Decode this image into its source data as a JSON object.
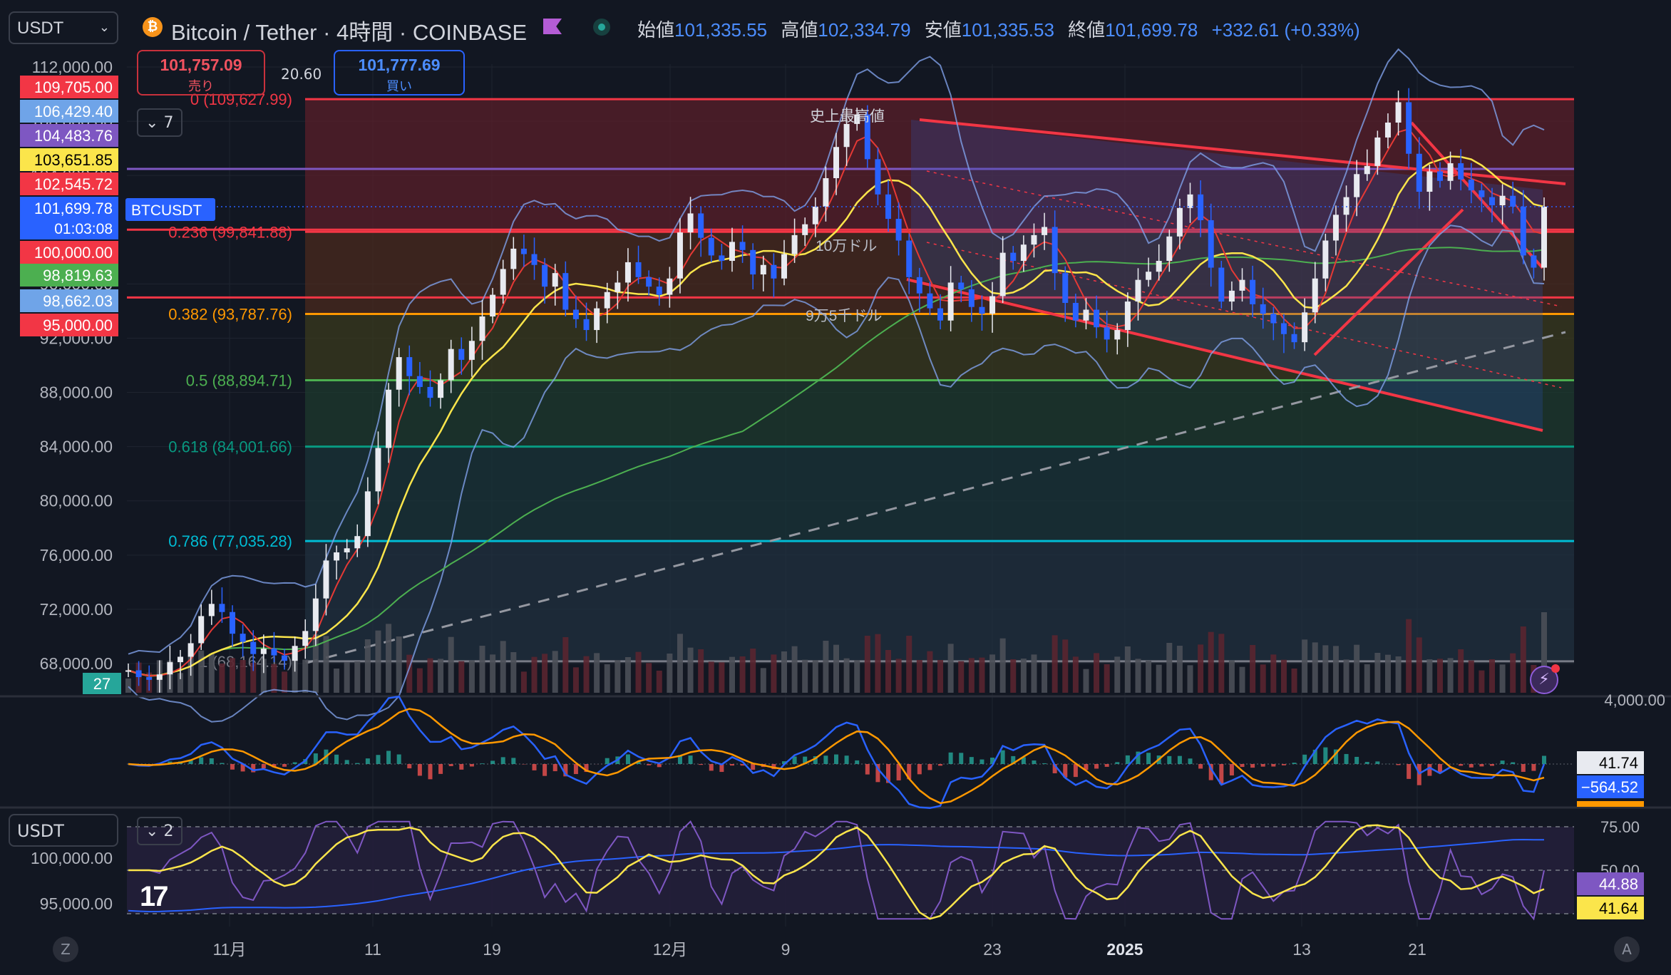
{
  "header": {
    "symbol_select": "USDT",
    "title": "Bitcoin / Tether · 4時間 · COINBASE",
    "ohlc": [
      {
        "k": "始値",
        "v": "101,335.55"
      },
      {
        "k": "高値",
        "v": "102,334.79"
      },
      {
        "k": "安値",
        "v": "101,335.53"
      },
      {
        "k": "終値",
        "v": "101,699.78"
      },
      {
        "k": "",
        "v": "+332.61 (+0.33%)"
      }
    ],
    "sell_price": "101,757.09",
    "sell_label": "売り",
    "spread": "20.60",
    "buy_price": "101,777.69",
    "buy_label": "買い",
    "collapse_count": "7"
  },
  "lower_pane": {
    "symbol_select": "USDT",
    "collapse_count": "2"
  },
  "colors": {
    "up": "#e8eaf0",
    "down": "#2962ff",
    "bb": "#7fa0e8",
    "ma_red": "#e53935",
    "ma_yellow": "#fbe54b",
    "ma_green": "#4caf50",
    "channel": "#f23645"
  },
  "icons": [
    "bitcoin-icon",
    "flag-icon",
    "live-dot-icon",
    "chevron-down-icon",
    "lightning-icon"
  ],
  "chart_data": {
    "type": "line",
    "main": {
      "price_axis_ticks": [
        "112,000.00",
        "108,000.00",
        "104,000.00",
        "100,000.00",
        "96,000.00",
        "92,000.00",
        "88,000.00",
        "84,000.00",
        "80,000.00",
        "76,000.00",
        "72,000.00",
        "68,000.00"
      ],
      "ylim": [
        66000,
        113000
      ],
      "x_ticks": [
        "11月",
        "11",
        "19",
        "12月",
        "9",
        "23",
        "2025",
        "13",
        "21"
      ],
      "price_labels": [
        {
          "value": 109705.0,
          "text": "109,705.00",
          "color": "#f23645"
        },
        {
          "value": 106429.4,
          "text": "106,429.40",
          "color": "#6fa4e8"
        },
        {
          "value": 104483.76,
          "text": "104,483.76",
          "color": "#7e57c2"
        },
        {
          "value": 103651.85,
          "text": "103,651.85",
          "color": "#fbe54b"
        },
        {
          "value": 102545.72,
          "text": "102,545.72",
          "color": "#f23645"
        },
        {
          "value": 101699.78,
          "text": "101,699.78",
          "color": "#2962ff"
        },
        {
          "value": 100000.0,
          "text": "100,000.00",
          "color": "#f23645"
        },
        {
          "value": 98819.63,
          "text": "98,819.63",
          "color": "#4caf50"
        },
        {
          "value": 98662.03,
          "text": "98,662.03",
          "color": "#6fa4e8"
        },
        {
          "value": 95000.0,
          "text": "95,000.00",
          "color": "#f23645"
        }
      ],
      "countdown": "01:03:08",
      "symbol_tag": "BTCUSDT",
      "bottom_tag": "27",
      "fib_levels": [
        {
          "ratio": "0",
          "text": "0 (109,627.99)",
          "value": 109627.99,
          "color": "#f23645"
        },
        {
          "ratio": "0.236",
          "text": "0.236 (99,841.88)",
          "value": 99841.88,
          "color": "#f23645"
        },
        {
          "ratio": "0.382",
          "text": "0.382 (93,787.76)",
          "value": 93787.76,
          "color": "#ff9800"
        },
        {
          "ratio": "0.5",
          "text": "0.5 (88,894.71)",
          "value": 88894.71,
          "color": "#4caf50"
        },
        {
          "ratio": "0.618",
          "text": "0.618 (84,001.66)",
          "value": 84001.66,
          "color": "#089981"
        },
        {
          "ratio": "0.786",
          "text": "0.786 (77,035.28)",
          "value": 77035.28,
          "color": "#00bcd4"
        },
        {
          "ratio": "1",
          "text": "1 (68,164.14)",
          "value": 68164.14,
          "color": "#787b86"
        }
      ],
      "horizontal_lines": [
        {
          "value": 104483.76,
          "color": "#7e57c2"
        },
        {
          "value": 100000.0,
          "color": "#f23645"
        },
        {
          "value": 95000.0,
          "color": "#f23645"
        }
      ],
      "annotations": [
        "史上最高値",
        "10万ドル",
        "9万5千ドル"
      ],
      "close_series": [
        67500,
        67000,
        66800,
        67200,
        68100,
        68500,
        69500,
        71500,
        72400,
        71800,
        70200,
        69600,
        68700,
        69100,
        68600,
        68200,
        69300,
        70400,
        72800,
        75600,
        76200,
        76500,
        77400,
        80700,
        83900,
        88200,
        90600,
        89200,
        88400,
        87600,
        88900,
        91200,
        90400,
        91800,
        93600,
        95200,
        97100,
        98600,
        98200,
        97400,
        95800,
        96800,
        94100,
        93400,
        92600,
        94200,
        95400,
        96100,
        97600,
        96500,
        95800,
        95200,
        96400,
        99800,
        101200,
        99400,
        98100,
        97700,
        99100,
        98500,
        96700,
        97400,
        96400,
        98200,
        99600,
        100400,
        101700,
        103800,
        106100,
        107800,
        108500,
        105200,
        102600,
        100800,
        99200,
        96500,
        95300,
        94200,
        93300,
        96100,
        95600,
        94300,
        93800,
        95100,
        98300,
        97700,
        98900,
        99600,
        100200,
        96800,
        94600,
        93300,
        94100,
        92800,
        91900,
        92600,
        94700,
        96300,
        96900,
        97700,
        99500,
        101600,
        102600,
        100700,
        97200,
        94700,
        95500,
        96300,
        94500,
        93800,
        93100,
        92300,
        91700,
        93900,
        96400,
        99200,
        101100,
        102400,
        104100,
        104700,
        106800,
        107900,
        109400,
        105600,
        102800,
        104300,
        103600,
        104900,
        103700,
        102900,
        102400,
        101800,
        102500,
        101700,
        98100,
        97200,
        101700
      ]
    },
    "macd": {
      "value_labels": [
        {
          "text": "41.74",
          "color": "#e8eaf0",
          "bg": "#e8eaf0"
        },
        {
          "text": "−564.52",
          "color": "#ffffff",
          "bg": "#2962ff"
        }
      ],
      "axis_tick": "4,000.00"
    },
    "rsi": {
      "levels": [
        75,
        50,
        25
      ],
      "axis_ticks": [
        "75.00",
        "50.00",
        "25.00"
      ],
      "left_ticks": [
        "100,000.00",
        "95,000.00"
      ],
      "value_labels": [
        {
          "text": "44.88",
          "color": "#ffffff",
          "bg": "#7e57c2"
        },
        {
          "text": "41.64",
          "color": "#000000",
          "bg": "#fbe54b"
        }
      ]
    }
  }
}
